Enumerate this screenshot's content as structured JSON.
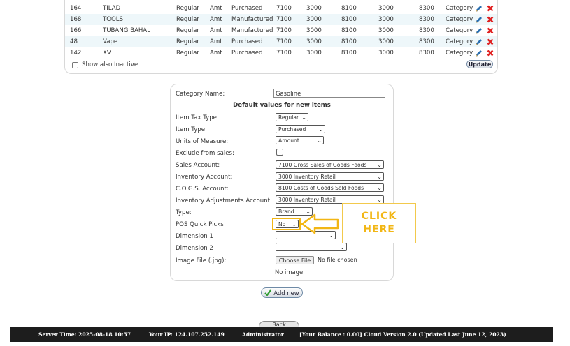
{
  "items_table": {
    "rows": [
      {
        "id": "164",
        "name": "TILAD",
        "tax": "Regular",
        "units": "Amt",
        "type": "Purchased",
        "sales": "7100",
        "inventory": "3000",
        "cogs": "8100",
        "adjustment": "3000",
        "dim": "8300",
        "category": "Category"
      },
      {
        "id": "168",
        "name": "TOOLS",
        "tax": "Regular",
        "units": "Amt",
        "type": "Manufactured",
        "sales": "7100",
        "inventory": "3000",
        "cogs": "8100",
        "adjustment": "3000",
        "dim": "8300",
        "category": "Category"
      },
      {
        "id": "166",
        "name": "TUBANG BAHAL",
        "tax": "Regular",
        "units": "Amt",
        "type": "Manufactured",
        "sales": "7100",
        "inventory": "3000",
        "cogs": "8100",
        "adjustment": "3000",
        "dim": "8300",
        "category": "Category"
      },
      {
        "id": "48",
        "name": "Vape",
        "tax": "Regular",
        "units": "Amt",
        "type": "Purchased",
        "sales": "7100",
        "inventory": "3000",
        "cogs": "8100",
        "adjustment": "3000",
        "dim": "8300",
        "category": "Category"
      },
      {
        "id": "142",
        "name": "XV",
        "tax": "Regular",
        "units": "Amt",
        "type": "Purchased",
        "sales": "7100",
        "inventory": "3000",
        "cogs": "8100",
        "adjustment": "3000",
        "dim": "8300",
        "category": "Category"
      }
    ],
    "show_inactive_label": "Show also Inactive",
    "update_label": "Update",
    "edit_icon_color": "#2a6fb0",
    "delete_icon_color": "#e02020"
  },
  "form": {
    "category_name_label": "Category Name:",
    "category_name_value": "Gasoline",
    "section_heading": "Default values for new items",
    "fields": {
      "item_tax_type": {
        "label": "Item Tax Type:",
        "value": "Regular"
      },
      "item_type": {
        "label": "Item Type:",
        "value": "Purchased"
      },
      "units": {
        "label": "Units of Measure:",
        "value": "Amount"
      },
      "exclude": {
        "label": "Exclude from sales:"
      },
      "sales_account": {
        "label": "Sales Account:",
        "value": "7100   Gross Sales of Goods Foods"
      },
      "inventory_account": {
        "label": "Inventory Account:",
        "value": "3000   Inventory Retail"
      },
      "cogs_account": {
        "label": "C.O.G.S. Account:",
        "value": "8100   Costs of Goods Sold Foods"
      },
      "adjust_account": {
        "label": "Inventory Adjustments Account:",
        "value": "3000   Inventory Retail"
      },
      "type": {
        "label": "Type:",
        "value": "Brand"
      },
      "pos_quick_picks": {
        "label": "POS Quick Picks",
        "value": "No"
      },
      "dimension1": {
        "label": "Dimension 1",
        "value": ""
      },
      "dimension2": {
        "label": "Dimension 2",
        "value": ""
      },
      "image_file": {
        "label": "Image File (.jpg):",
        "button": "Choose File",
        "status": "No file chosen",
        "preview": "No image"
      }
    }
  },
  "callout": {
    "line1": "CLICK",
    "line2": "HERE",
    "color": "#f2b614"
  },
  "add_new_label": "Add new",
  "back_label": "Back",
  "footer": {
    "server_time": "Server Time: 2025-08-18 10:57",
    "ip": "Your IP: 124.107.252.149",
    "user": "Administrator",
    "balance": "[Your Balance : 0.00] Cloud Version 2.0 (Updated Last June 12, 2023)"
  }
}
